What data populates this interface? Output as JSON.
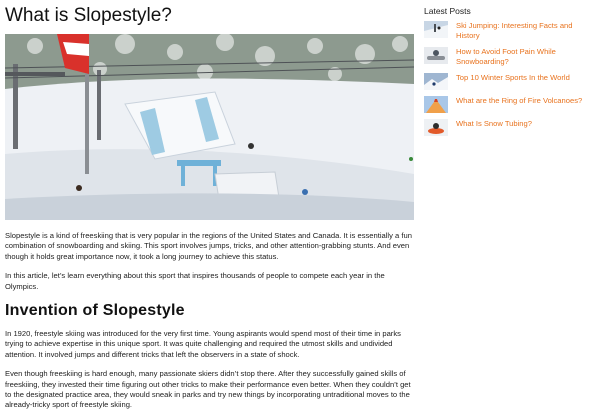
{
  "article": {
    "title": "What is Slopestyle?",
    "intro_paragraphs": [
      "Slopestyle is a kind of freeskiing that is very popular in the regions of the United States and Canada. It is essentially a fun combination of snowboarding and skiing. This sport involves jumps, tricks, and other attention-grabbing stunts. And even though it holds great importance now, it took a long journey to achieve this status.",
      "In this article, let’s learn everything about this sport that inspires thousands of people to compete each year in the Olympics."
    ],
    "section_heading": "Invention of Slopestyle",
    "section_paragraphs": [
      "In 1920, freestyle skiing was introduced for the very first time. Young aspirants would spend most of their time in parks trying to achieve expertise in this unique sport. It was quite challenging and required the utmost skills and undivided attention. It involved jumps and different tricks that left the observers in a state of shock.",
      "Even though freeskiing is hard enough, many passionate skiers didn’t stop there. After they successfully gained skills of freeskiing, they invested their time figuring out other tricks to make their performance even better. When they couldn’t get to the designated practice area, they would sneak in parks and try new things by incorporating untraditional moves to the already-tricky sport of freestyle skiing."
    ]
  },
  "sidebar": {
    "title": "Latest Posts",
    "posts": [
      {
        "label": "Ski Jumping: Interesting Facts and History",
        "thumb": "ski-jump-thumbnail"
      },
      {
        "label": "How to Avoid Foot Pain While Snowboarding?",
        "thumb": "snowboard-thumbnail"
      },
      {
        "label": "Top 10 Winter Sports In the World",
        "thumb": "winter-sports-thumbnail"
      },
      {
        "label": "What are the Ring of Fire Volcanoes?",
        "thumb": "volcano-thumbnail"
      },
      {
        "label": "What Is Snow Tubing?",
        "thumb": "snow-tubing-thumbnail"
      }
    ]
  },
  "colors": {
    "link": "#e8731f",
    "text": "#222222"
  }
}
